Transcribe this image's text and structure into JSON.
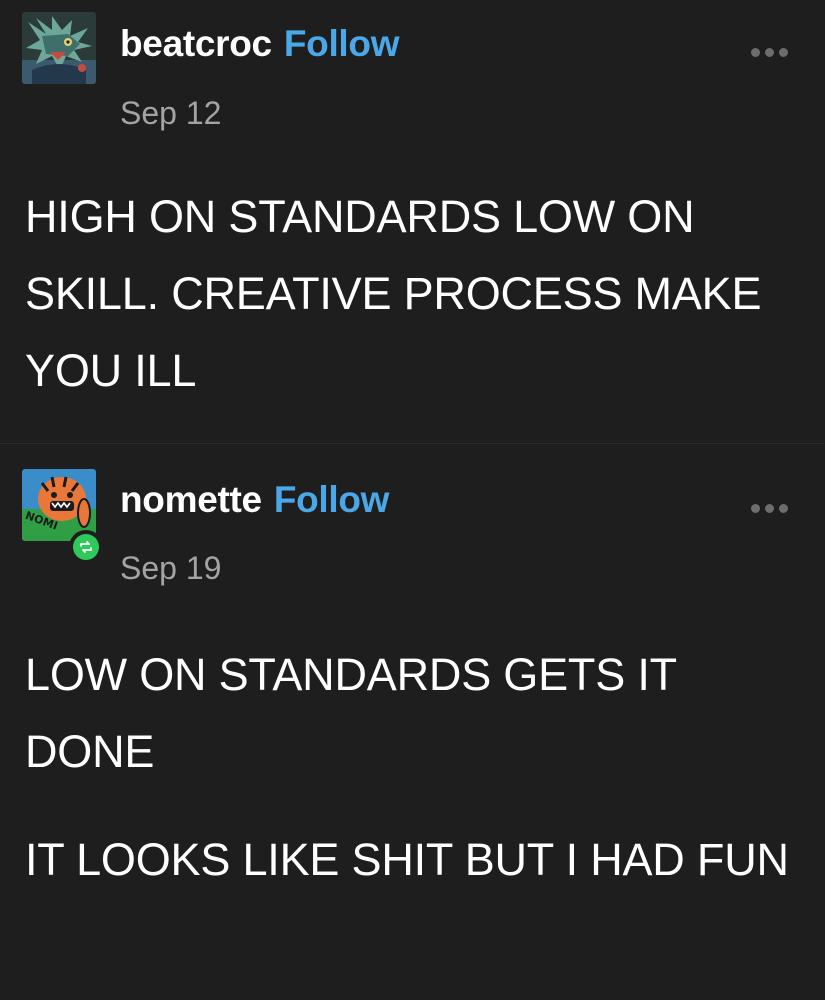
{
  "posts": [
    {
      "username": "beatcroc",
      "follow_label": "Follow",
      "date": "Sep 12",
      "paragraphs": [
        "HIGH ON STANDARDS LOW ON SKILL. CREATIVE PROCESS MAKE YOU ILL"
      ],
      "avatar_icon": "crocodile-avatar-icon",
      "more_icon": "more-options-icon"
    },
    {
      "username": "nomette",
      "follow_label": "Follow",
      "date": "Sep 19",
      "paragraphs": [
        "LOW ON STANDARDS GETS IT DONE",
        "IT LOOKS LIKE SHIT BUT I HAD FUN"
      ],
      "avatar_icon": "tiger-avatar-icon",
      "avatar_text": "NOMI",
      "badge_icon": "reblog-icon",
      "more_icon": "more-options-icon"
    }
  ],
  "colors": {
    "background": "#1e1e1f",
    "text": "#ffffff",
    "follow": "#4aa8e8",
    "date": "#a3a3a5",
    "reblog_badge": "#2ec95b"
  }
}
